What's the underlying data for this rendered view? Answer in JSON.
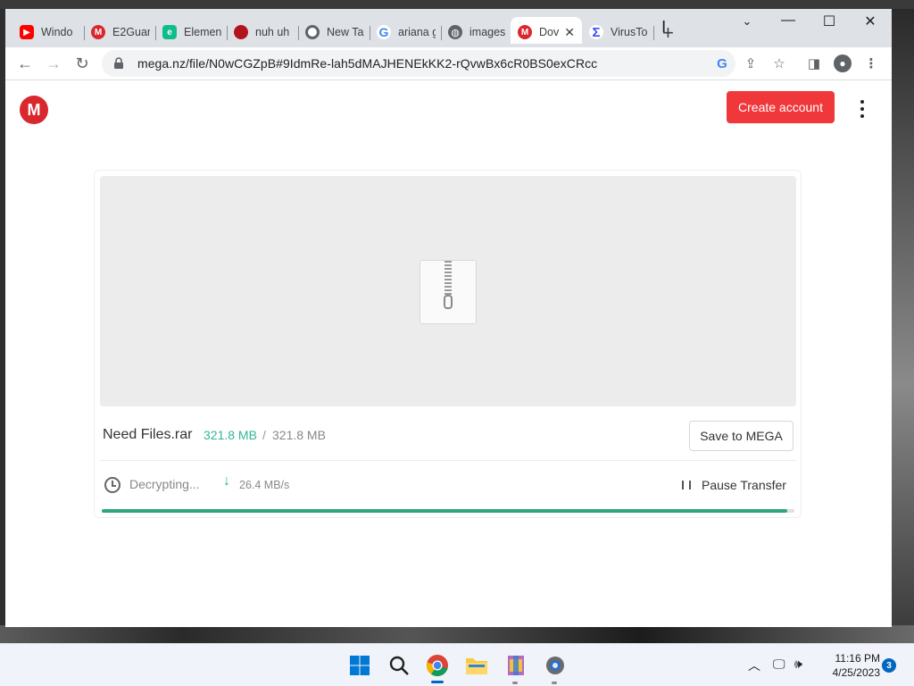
{
  "browser": {
    "tabs": [
      {
        "title": "Windo",
        "favicon": "youtube-icon",
        "color": "#ff0000"
      },
      {
        "title": "E2Guar",
        "favicon": "mega-icon",
        "color": "#d9272e"
      },
      {
        "title": "Elemen",
        "favicon": "element-icon",
        "color": "#0dbd8b"
      },
      {
        "title": "nuh uh",
        "favicon": "red-dot-icon",
        "color": "#b3141c"
      },
      {
        "title": "New Ta",
        "favicon": "chrome-icon",
        "color": "#5f6368"
      },
      {
        "title": "ariana g",
        "favicon": "google-icon",
        "color": "#4285f4"
      },
      {
        "title": "images",
        "favicon": "globe-icon",
        "color": "#5f6368"
      },
      {
        "title": "Dov",
        "favicon": "mega-icon",
        "color": "#d9272e",
        "active": true
      },
      {
        "title": "VirusTo",
        "favicon": "virustotal-icon",
        "color": "#394eff"
      }
    ],
    "url": "mega.nz/file/N0wCGZpB#9IdmRe-lah5dMAJHENEkKK2-rQvwBx6cR0BS0exCRcc"
  },
  "page": {
    "logo_letter": "M",
    "create_account_label": "Create account",
    "file": {
      "name": "Need Files.rar",
      "downloaded": "321.8 MB",
      "separator": "/",
      "total": "321.8 MB",
      "save_label": "Save to MEGA"
    },
    "status": {
      "state": "Decrypting...",
      "speed": "26.4 MB/s",
      "pause_label": "Pause Transfer",
      "progress_percent": 99
    }
  },
  "taskbar": {
    "time": "11:16 PM",
    "date": "4/25/2023",
    "notification_count": "3"
  },
  "colors": {
    "accent_red": "#f0373a",
    "progress_green": "#2ba57a",
    "downloaded_green": "#32b596"
  }
}
